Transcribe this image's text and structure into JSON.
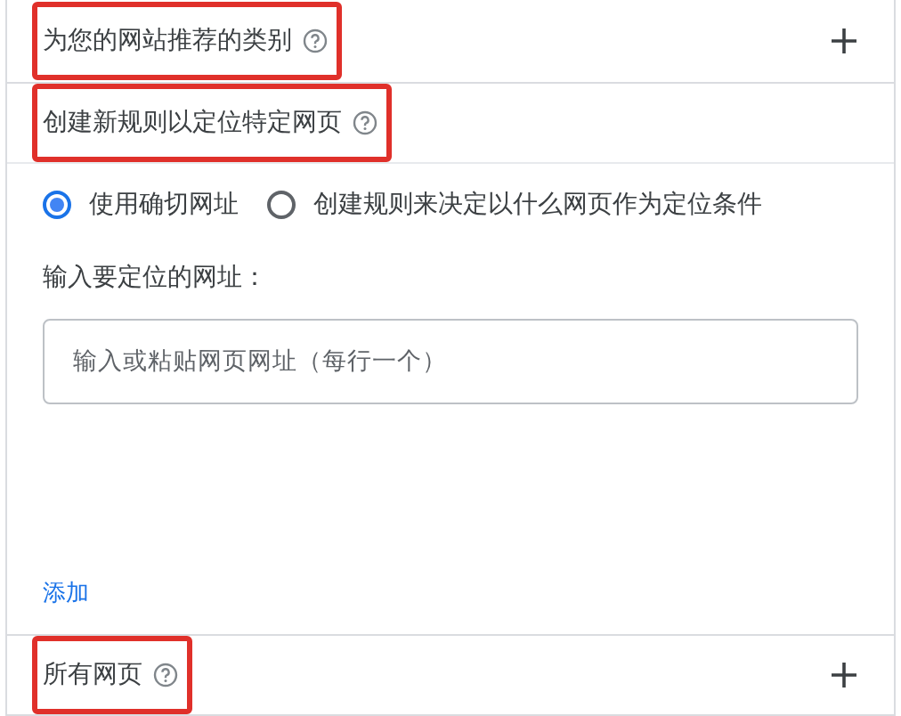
{
  "sections": [
    {
      "title": "为您的网站推荐的类别",
      "highlighted": true,
      "expandable": true
    },
    {
      "title": "创建新规则以定位特定网页",
      "highlighted": true,
      "expandable": false,
      "options": [
        {
          "label": "使用确切网址",
          "selected": true
        },
        {
          "label": "创建规则来决定以什么网页作为定位条件",
          "selected": false
        }
      ],
      "url_label": "输入要定位的网址：",
      "url_field": {
        "placeholder": "输入或粘贴网页网址（每行一个）"
      },
      "add_link": "添加"
    },
    {
      "title": "所有网页",
      "highlighted": true,
      "expandable": true
    }
  ]
}
